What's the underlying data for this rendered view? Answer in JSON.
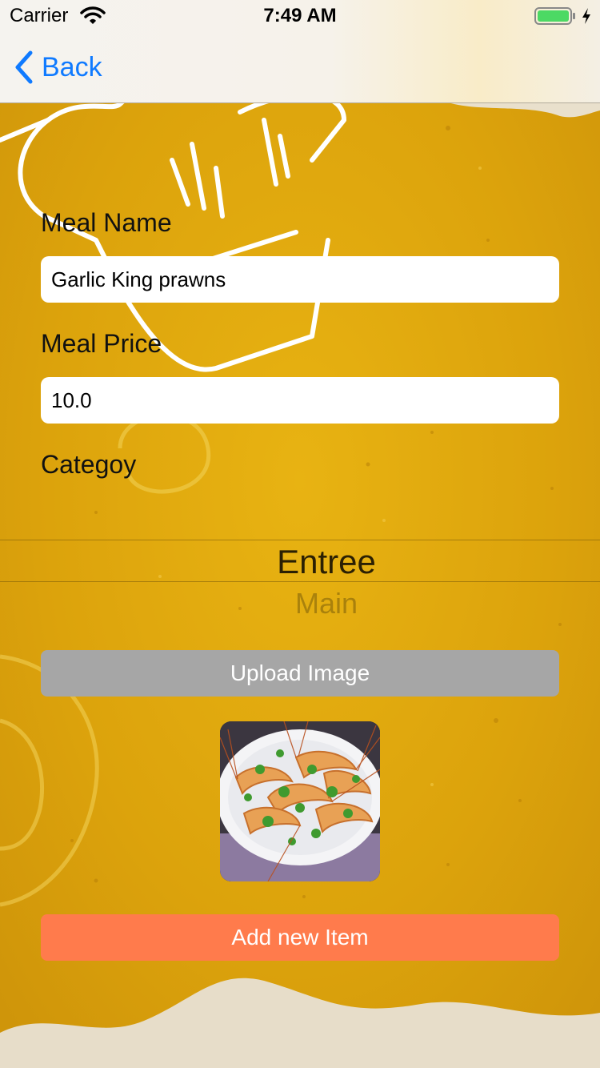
{
  "status_bar": {
    "carrier": "Carrier",
    "time": "7:49 AM",
    "battery_icon": "battery-charging-icon",
    "wifi_icon": "wifi-icon"
  },
  "nav": {
    "back_label": "Back",
    "back_icon": "chevron-left-icon"
  },
  "form": {
    "meal_name_label": "Meal Name",
    "meal_name_value": "Garlic King prawns",
    "meal_price_label": "Meal Price",
    "meal_price_value": "10.0",
    "category_label": "Categoy",
    "category_picker": {
      "selected": "Entree",
      "next": "Main"
    }
  },
  "actions": {
    "upload_label": "Upload Image",
    "add_label": "Add new Item"
  },
  "colors": {
    "accent_blue": "#0f7aff",
    "background_yellow": "#d9a20a",
    "upload_button": "#a6a6a6",
    "add_button": "#ff7b4c"
  }
}
